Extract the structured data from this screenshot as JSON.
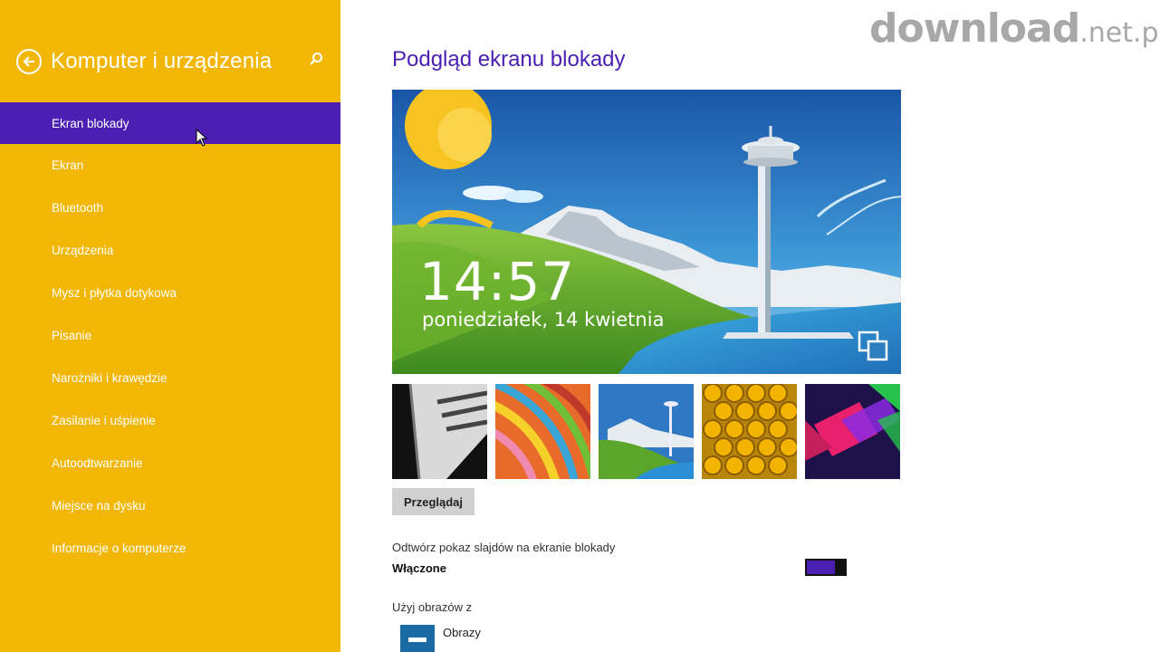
{
  "sidebar": {
    "title": "Komputer i urządzenia",
    "items": [
      {
        "label": "Ekran blokady",
        "active": true
      },
      {
        "label": "Ekran"
      },
      {
        "label": "Bluetooth"
      },
      {
        "label": "Urządzenia"
      },
      {
        "label": "Mysz i płytka dotykowa"
      },
      {
        "label": "Pisanie"
      },
      {
        "label": "Narożniki i krawędzie"
      },
      {
        "label": "Zasilanie i uśpienie"
      },
      {
        "label": "Autoodtwarzanie"
      },
      {
        "label": "Miejsce na dysku"
      },
      {
        "label": "Informacje o komputerze"
      }
    ]
  },
  "main": {
    "title": "Podgląd ekranu blokady",
    "preview": {
      "time": "14:57",
      "date": "poniedziałek, 14 kwietnia"
    },
    "thumbnails": [
      "piano",
      "stripes",
      "seattle",
      "honeycomb",
      "geometric"
    ],
    "browse_label": "Przeglądaj",
    "slideshow_label": "Odtwórz pokaz slajdów na ekranie blokady",
    "toggle_state": "Włączone",
    "toggle_on": true,
    "use_images_label": "Użyj obrazów z",
    "folder_label": "Obrazy"
  },
  "watermark": {
    "main": "download",
    "suffix": ".net.pl"
  },
  "colors": {
    "sidebar_bg": "#f2b705",
    "accent": "#4a1fb2",
    "folder_icon": "#1a6aa3"
  },
  "icons": {
    "back": "back-arrow-icon",
    "search": "search-icon",
    "slideshow": "slideshow-icon",
    "folder": "pictures-folder-icon"
  }
}
